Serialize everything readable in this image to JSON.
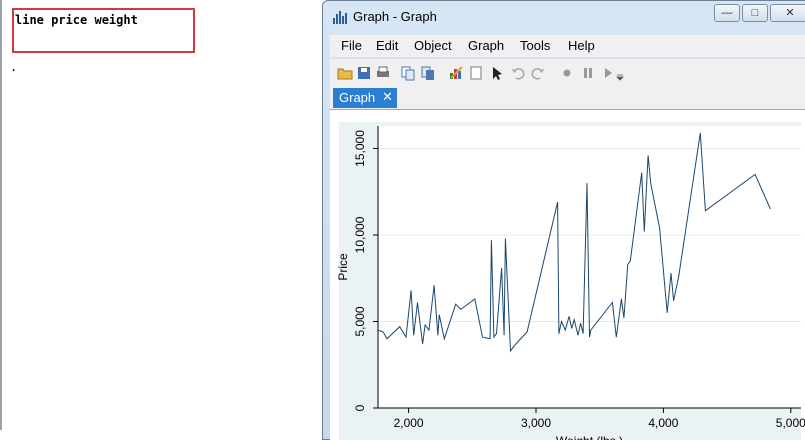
{
  "results": {
    "command": "line price weight",
    "prompt": "."
  },
  "window": {
    "title": "Graph - Graph",
    "minimize_label": "—",
    "maximize_label": "□",
    "close_label": "✕"
  },
  "menu": [
    "File",
    "Edit",
    "Object",
    "Graph",
    "Tools",
    "Help"
  ],
  "toolbar": {
    "icons": [
      "open-icon",
      "save-icon",
      "print-icon",
      "copy-icon",
      "copy-special-icon",
      "graph-editor-icon",
      "page-icon",
      "pointer-icon",
      "undo-icon",
      "redo-icon",
      "record-icon",
      "pause-icon",
      "play-icon",
      "dropdown-icon"
    ]
  },
  "tab": {
    "label": "Graph",
    "close": "✕"
  },
  "colors": {
    "line": "#1a476f",
    "plot_bg": "#ffffff",
    "region_bg": "#eaf2f3",
    "tab_bg": "#2b7ed1"
  },
  "chart_data": {
    "type": "line",
    "xlabel": "Weight (lbs.)",
    "ylabel": "Price",
    "xlim": [
      1760,
      5080
    ],
    "ylim": [
      0,
      16300
    ],
    "xticks": [
      2000,
      3000,
      4000,
      5000
    ],
    "xtick_labels": [
      "2,000",
      "3,000",
      "4,000",
      "5,000"
    ],
    "yticks": [
      0,
      5000,
      10000,
      15000
    ],
    "ytick_labels": [
      "0",
      "5,000",
      "10,000",
      "15,000"
    ],
    "grid": true,
    "series": [
      {
        "x": [
          1760,
          1800,
          1830,
          1930,
          1980,
          2020,
          2040,
          2070,
          2110,
          2130,
          2160,
          2200,
          2230,
          2240,
          2280,
          2370,
          2410,
          2520,
          2580,
          2640,
          2650,
          2670,
          2690,
          2730,
          2750,
          2760,
          2800,
          2830,
          2930,
          3170,
          3180,
          3200,
          3230,
          3260,
          3280,
          3300,
          3330,
          3350,
          3370,
          3400,
          3420,
          3430,
          3600,
          3630,
          3670,
          3690,
          3700,
          3720,
          3740,
          3830,
          3850,
          3880,
          3900,
          3970,
          4030,
          4060,
          4080,
          4120,
          4290,
          4330,
          4720,
          4840
        ],
        "y": [
          4500,
          4400,
          4000,
          4700,
          4100,
          6800,
          4200,
          6100,
          3700,
          4800,
          4500,
          7100,
          4200,
          5400,
          4000,
          6000,
          5700,
          6300,
          4100,
          4000,
          9700,
          4100,
          4300,
          8100,
          4200,
          9800,
          3300,
          3600,
          4400,
          11900,
          4300,
          5000,
          4500,
          5300,
          4600,
          5100,
          4200,
          4900,
          4300,
          13000,
          4100,
          4500,
          6100,
          4100,
          6300,
          5200,
          6200,
          8300,
          8500,
          13600,
          10200,
          14600,
          13000,
          10400,
          5500,
          7800,
          6200,
          7600,
          15900,
          11400,
          13500,
          11500
        ]
      }
    ]
  }
}
